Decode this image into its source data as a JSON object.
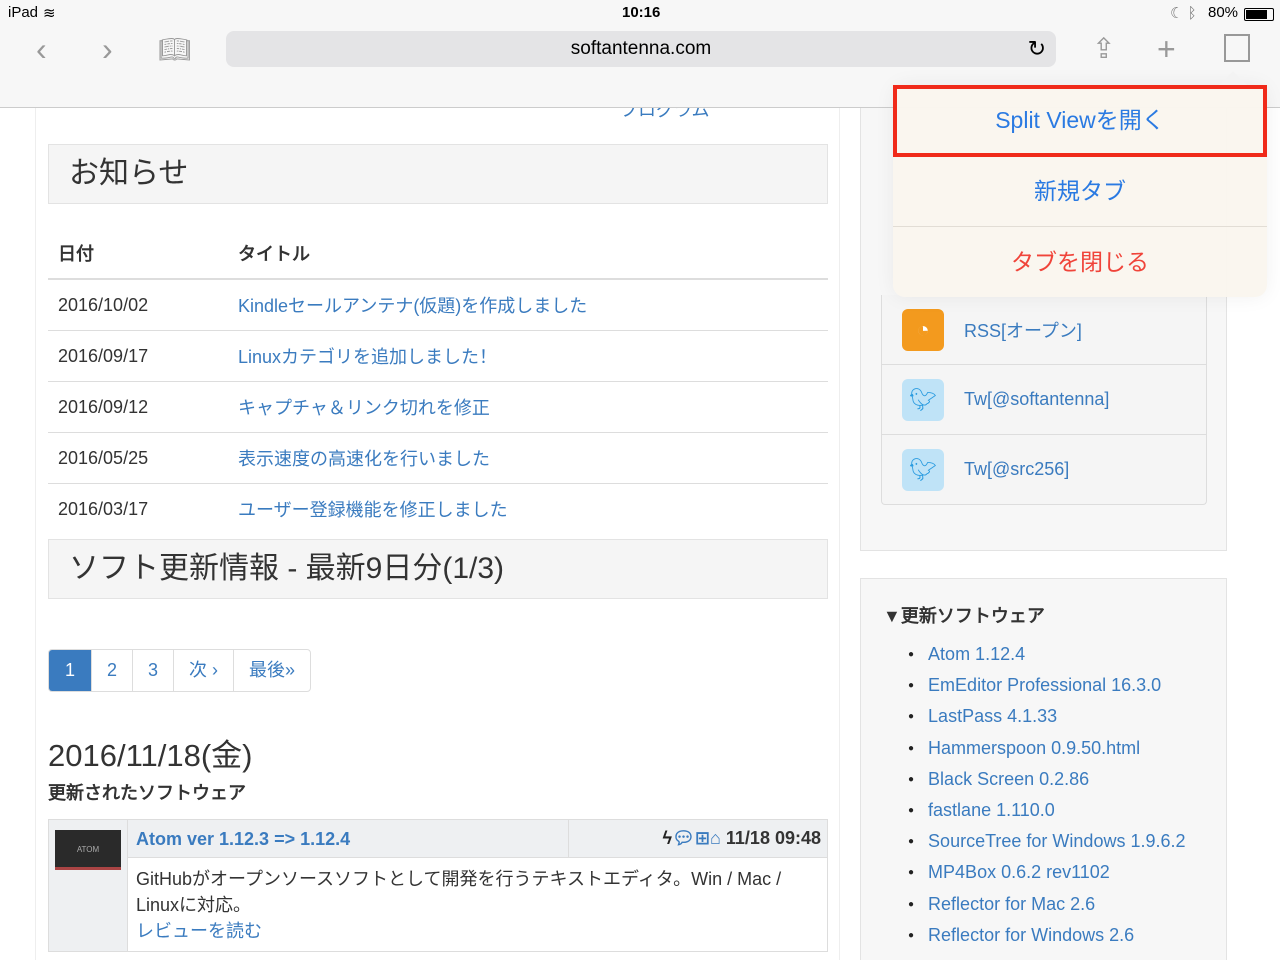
{
  "status": {
    "device": "iPad",
    "time": "10:16",
    "battery": "80%"
  },
  "browser": {
    "url": "softantenna.com"
  },
  "popover": {
    "items": [
      "Split Viewを開く",
      "新規タブ",
      "タブを閉じる"
    ]
  },
  "main": {
    "top_fragment": "プログラム",
    "news_title": "お知らせ",
    "news_headers": [
      "日付",
      "タイトル"
    ],
    "news": [
      {
        "date": "2016/10/02",
        "title": "Kindleセールアンテナ(仮題)を作成しました"
      },
      {
        "date": "2016/09/17",
        "title": "Linuxカテゴリを追加しました！"
      },
      {
        "date": "2016/09/12",
        "title": "キャプチャ＆リンク切れを修正"
      },
      {
        "date": "2016/05/25",
        "title": "表示速度の高速化を行いました"
      },
      {
        "date": "2016/03/17",
        "title": "ユーザー登録機能を修正しました"
      }
    ],
    "updates_title": "ソフト更新情報 - 最新9日分(1/3)",
    "pager": [
      "1",
      "2",
      "3",
      "次 ›",
      "最後»"
    ],
    "date_heading": "2016/11/18(金)",
    "sub_heading": "更新されたソフトウェア",
    "entry": {
      "title": "Atom ver 1.12.3 => 1.12.4",
      "time": "11/18 09:48",
      "desc": "GitHubがオープンソースソフトとして開発を行うテキストエディタ。Win / Mac / Linuxに対応。",
      "review": "レビューを読む",
      "thumb_text": "ATOM"
    }
  },
  "sidebar": {
    "social": [
      "RSS[オープン]",
      "Tw[@softantenna]",
      "Tw[@src256]"
    ],
    "updated_title": "▼更新ソフトウェア",
    "updated": [
      "Atom 1.12.4",
      "EmEditor Professional 16.3.0",
      "LastPass 4.1.33",
      "Hammerspoon 0.9.50.html",
      "Black Screen 0.2.86",
      "fastlane 1.110.0",
      "SourceTree for Windows 1.9.6.2",
      "MP4Box 0.6.2 rev1102",
      "Reflector for Mac 2.6",
      "Reflector for Windows 2.6"
    ]
  }
}
